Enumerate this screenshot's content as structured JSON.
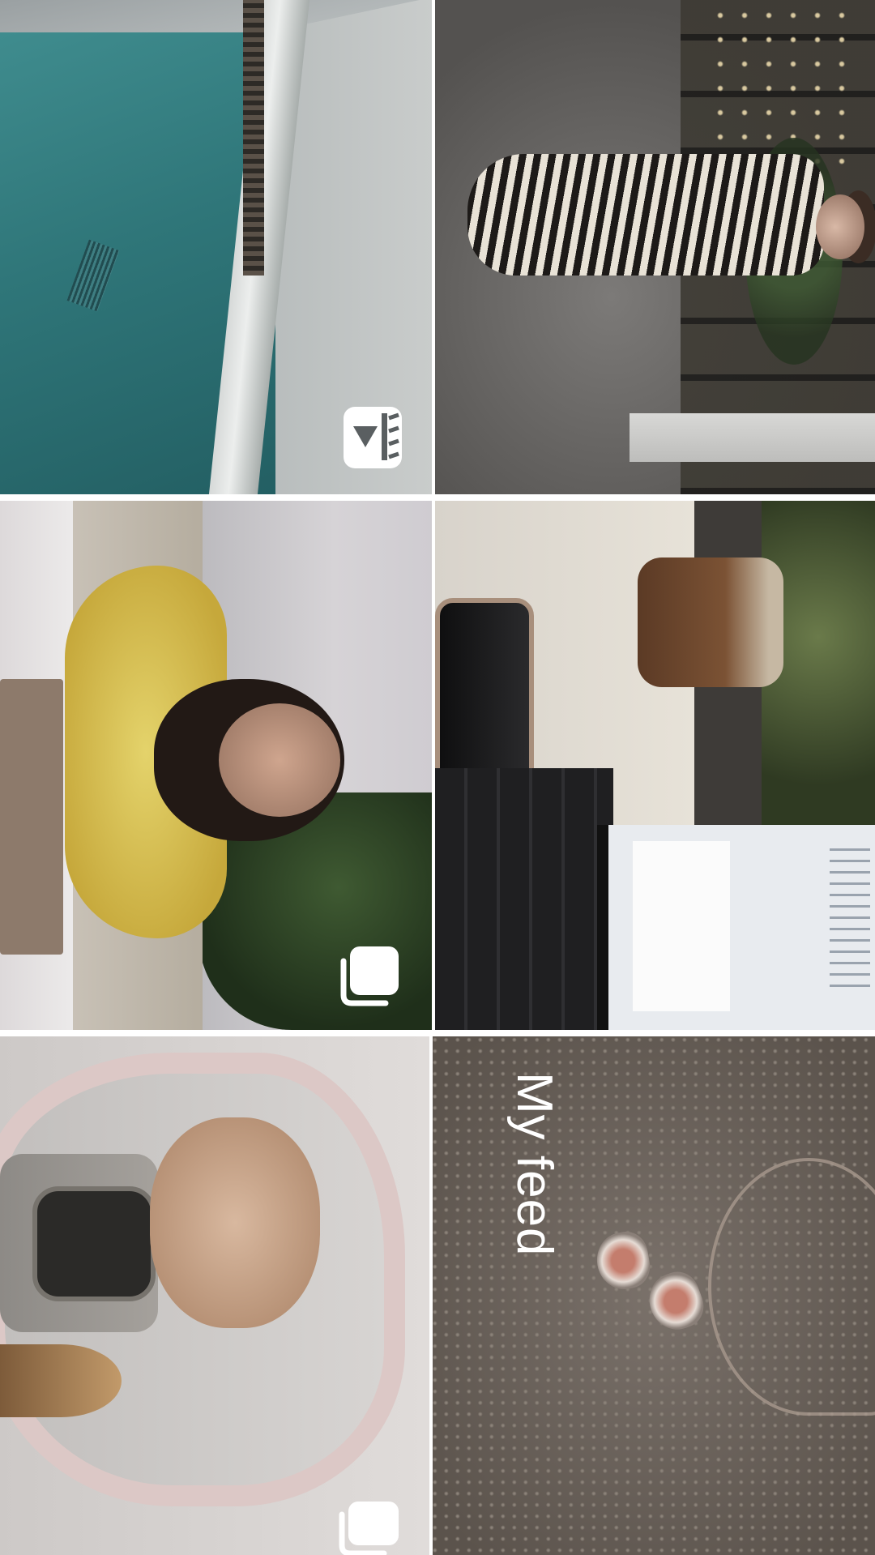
{
  "screen": {
    "overlay_text": "My feed"
  },
  "grid": {
    "tiles": [
      {
        "id": "pool",
        "badge": "reel-icon"
      },
      {
        "id": "zebra-outfit",
        "badge": null
      },
      {
        "id": "yellow-dress",
        "badge": "carousel-icon"
      },
      {
        "id": "coffee-laptop",
        "badge": null
      },
      {
        "id": "mirror-selfie",
        "badge": "carousel-icon"
      },
      {
        "id": "sand-hearts",
        "badge": null
      }
    ]
  },
  "colors": {
    "badge_fill": "#ffffff",
    "text": "#ffffff"
  }
}
